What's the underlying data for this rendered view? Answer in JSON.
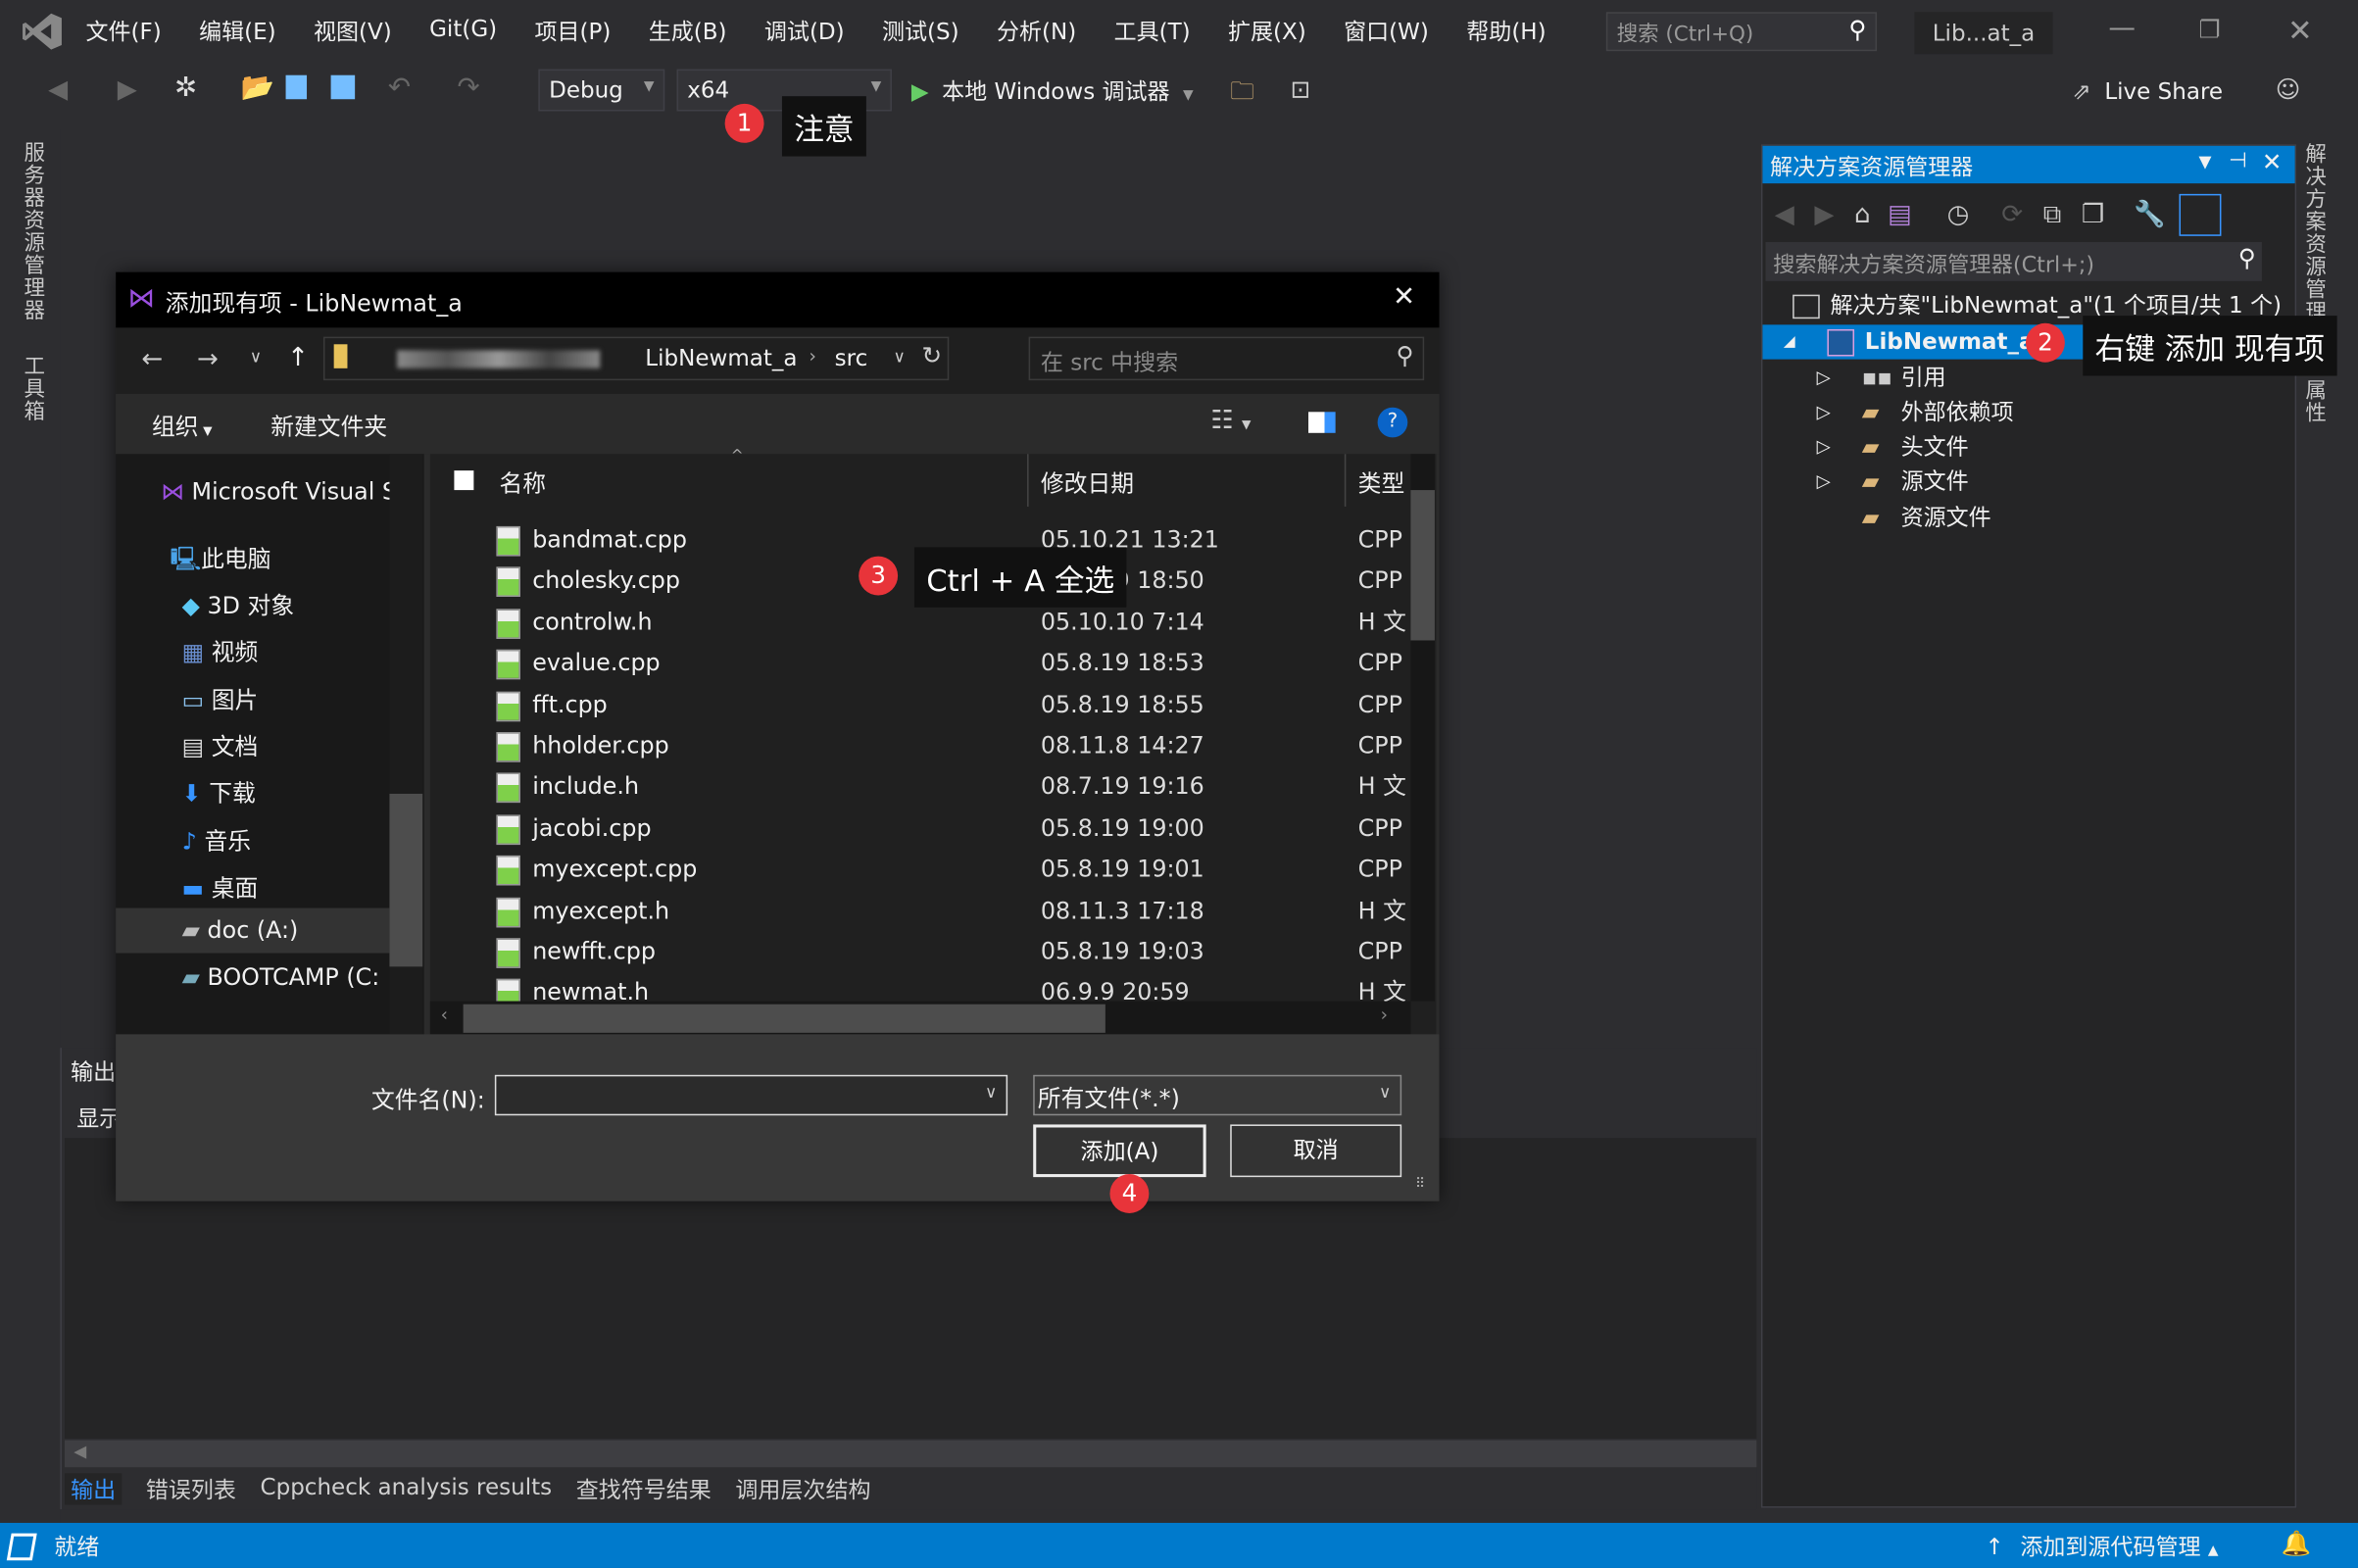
{
  "window": {
    "title_badge": "Lib...at_a",
    "search_placeholder": "搜索 (Ctrl+Q)"
  },
  "menu": [
    "文件(F)",
    "编辑(E)",
    "视图(V)",
    "Git(G)",
    "项目(P)",
    "生成(B)",
    "调试(D)",
    "测试(S)",
    "分析(N)",
    "工具(T)",
    "扩展(X)",
    "窗口(W)",
    "帮助(H)"
  ],
  "toolbar": {
    "config": "Debug",
    "platform": "x64",
    "run_label": "本地 Windows 调试器",
    "live_share": "Live Share"
  },
  "left_strip": {
    "server_explorer": "服务器资源管理器",
    "toolbox": "工具箱"
  },
  "right_strip": {
    "solution_explorer": "解决方案资源管理器",
    "properties": "属性"
  },
  "callouts": [
    {
      "number": "1",
      "text": "注意"
    },
    {
      "number": "2",
      "text": "右键 添加 现有项"
    },
    {
      "number": "3",
      "text": "Ctrl + A 全选"
    },
    {
      "number": "4",
      "text": ""
    }
  ],
  "solution_explorer": {
    "title": "解决方案资源管理器",
    "search_placeholder": "搜索解决方案资源管理器(Ctrl+;)",
    "solution": "解决方案\"LibNewmat_a\"(1 个项目/共 1 个)",
    "project": "LibNewmat_a",
    "children": [
      "引用",
      "外部依赖项",
      "头文件",
      "源文件",
      "资源文件"
    ]
  },
  "dialog": {
    "title": "添加现有项 - LibNewmat_a",
    "breadcrumb": [
      "LibNewmat_a",
      "src"
    ],
    "search_placeholder": "在 src 中搜索",
    "organize": "组织",
    "new_folder": "新建文件夹",
    "nav": [
      "Microsoft Visual S",
      "此电脑",
      "3D 对象",
      "视频",
      "图片",
      "文档",
      "下载",
      "音乐",
      "桌面",
      "doc (A:)",
      "BOOTCAMP (C:"
    ],
    "columns": {
      "name": "名称",
      "date": "修改日期",
      "type": "类型"
    },
    "files": [
      {
        "name": "bandmat.cpp",
        "date": "05.10.21 13:21",
        "type": "CPP"
      },
      {
        "name": "cholesky.cpp",
        "date": "05.8.19 18:50",
        "type": "CPP"
      },
      {
        "name": "controlw.h",
        "date": "05.10.10 7:14",
        "type": "H 文"
      },
      {
        "name": "evalue.cpp",
        "date": "05.8.19 18:53",
        "type": "CPP"
      },
      {
        "name": "fft.cpp",
        "date": "05.8.19 18:55",
        "type": "CPP"
      },
      {
        "name": "hholder.cpp",
        "date": "08.11.8 14:27",
        "type": "CPP"
      },
      {
        "name": "include.h",
        "date": "08.7.19 19:16",
        "type": "H 文"
      },
      {
        "name": "jacobi.cpp",
        "date": "05.8.19 19:00",
        "type": "CPP"
      },
      {
        "name": "myexcept.cpp",
        "date": "05.8.19 19:01",
        "type": "CPP"
      },
      {
        "name": "myexcept.h",
        "date": "08.11.3 17:18",
        "type": "H 文"
      },
      {
        "name": "newfft.cpp",
        "date": "05.8.19 19:03",
        "type": "CPP"
      },
      {
        "name": "newmat.h",
        "date": "06.9.9 20:59",
        "type": "H 文"
      }
    ],
    "filename_label": "文件名(N):",
    "filename_value": "",
    "filter": "所有文件(*.*)",
    "add": "添加(A)",
    "cancel": "取消"
  },
  "output": {
    "title": "输出",
    "show_label": "显示",
    "tabs": [
      "输出",
      "错误列表",
      "Cppcheck analysis results",
      "查找符号结果",
      "调用层次结构"
    ]
  },
  "status": {
    "text": "就绪",
    "source_control": "添加到源代码管理"
  },
  "colors": {
    "accent": "#007acc",
    "badge": "#e8343a",
    "bg": "#2d2d30"
  }
}
